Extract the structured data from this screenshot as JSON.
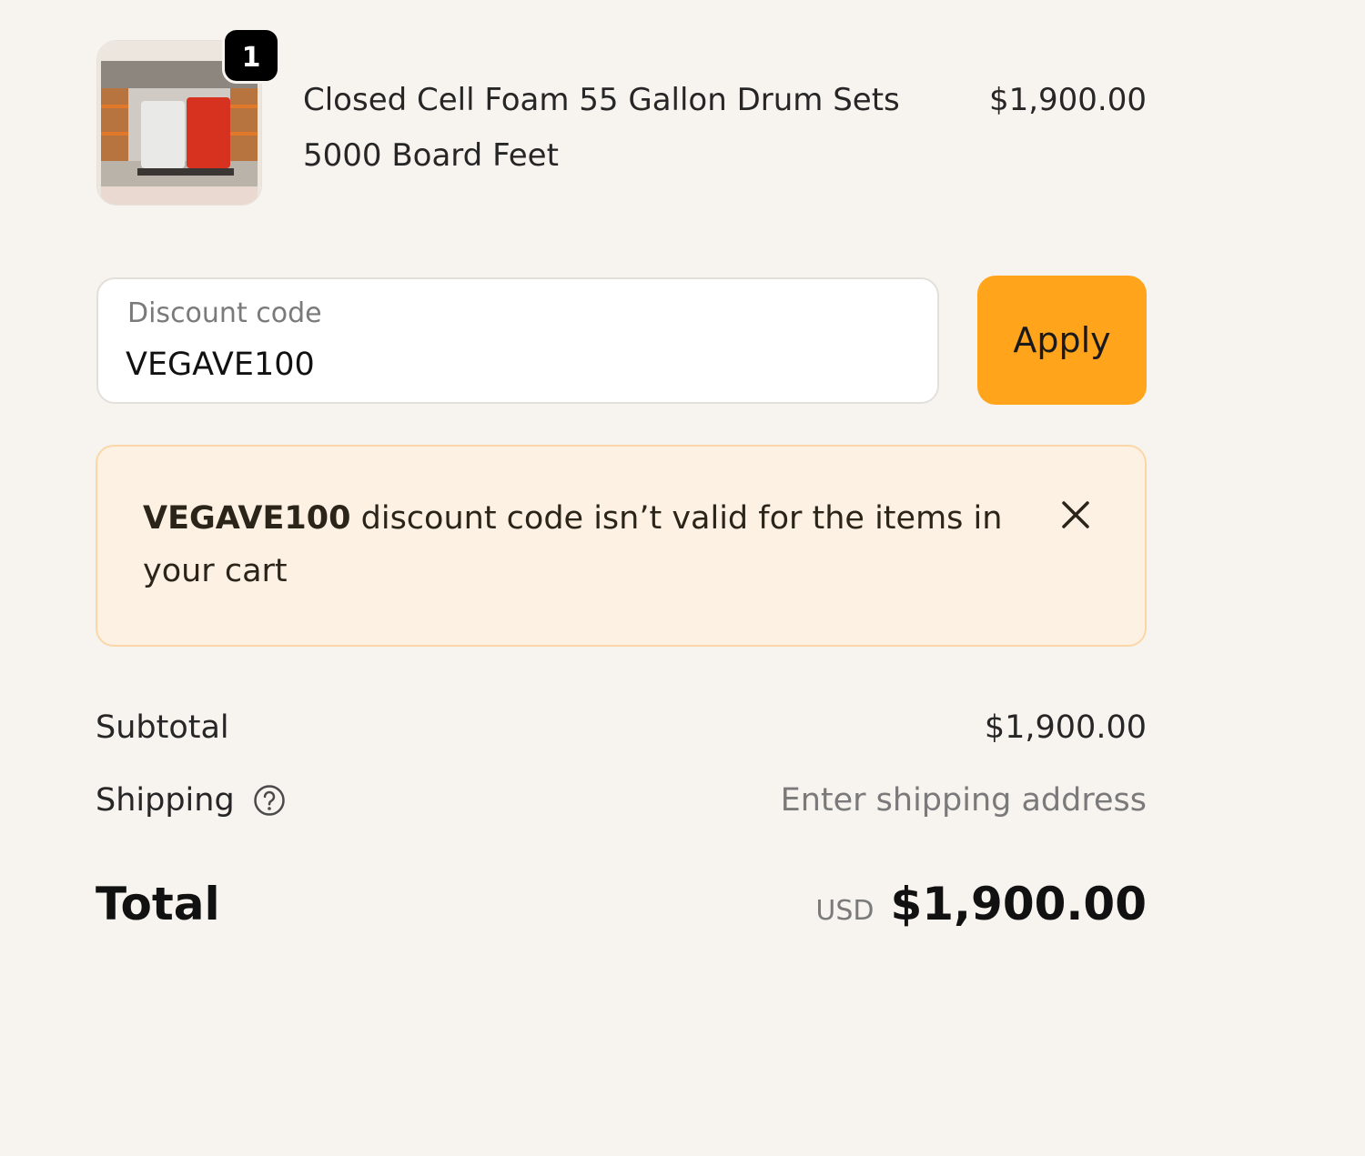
{
  "cart": {
    "item": {
      "quantity": "1",
      "name": "Closed Cell Foam 55 Gallon Drum Sets 5000 Board Feet",
      "price": "$1,900.00",
      "image": "product-thumbnail-warehouse-drums"
    }
  },
  "discount": {
    "label": "Discount code",
    "value": "VEGAVE100",
    "apply_label": "Apply"
  },
  "notice": {
    "code": "VEGAVE100",
    "message": " discount code isn’t valid for the items in your cart",
    "close_icon": "close-icon"
  },
  "summary": {
    "subtotal_label": "Subtotal",
    "subtotal_value": "$1,900.00",
    "shipping_label": "Shipping",
    "shipping_help_icon": "question-circle-icon",
    "shipping_value": "Enter shipping address",
    "total_label": "Total",
    "currency": "USD",
    "total_value": "$1,900.00"
  },
  "colors": {
    "background": "#f7f3ef",
    "accent": "#ffa41b",
    "notice_background": "#fdf1e4",
    "notice_border": "#fbd7a8"
  }
}
